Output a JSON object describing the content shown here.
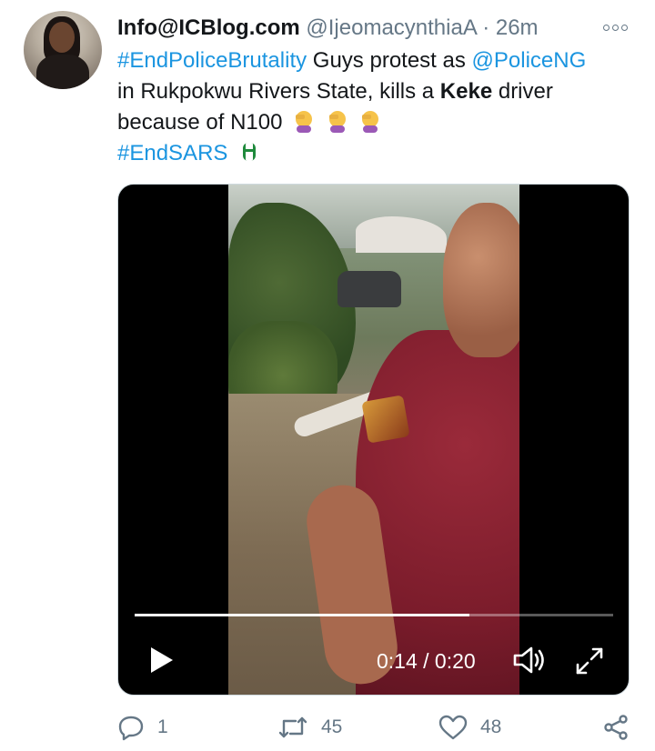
{
  "tweet": {
    "author_name": "Info@ICBlog.com",
    "author_handle": "@IjeomacynthiaA",
    "separator": "·",
    "time": "26m",
    "text": {
      "hashtag1": "#EndPoliceBrutality",
      "part1": " Guys protest as ",
      "mention": "@PoliceNG",
      "part2": "in Rukpokwu Rivers State, kills a ",
      "bold_word": "Keke",
      "part3": " driver",
      "part4": "because of N100",
      "hashtag2": "#EndSARS"
    }
  },
  "video": {
    "time_display": "0:14 / 0:20",
    "progress": 0.7
  },
  "actions": {
    "reply_count": "1",
    "retweet_count": "45",
    "like_count": "48"
  },
  "icons": {
    "more": "more-options-icon",
    "play": "play-icon",
    "volume": "volume-icon",
    "fullscreen": "fullscreen-icon",
    "reply": "reply-icon",
    "retweet": "retweet-icon",
    "like": "heart-icon",
    "share": "share-icon"
  },
  "colors": {
    "link": "#1b95e0",
    "muted": "#657786"
  }
}
